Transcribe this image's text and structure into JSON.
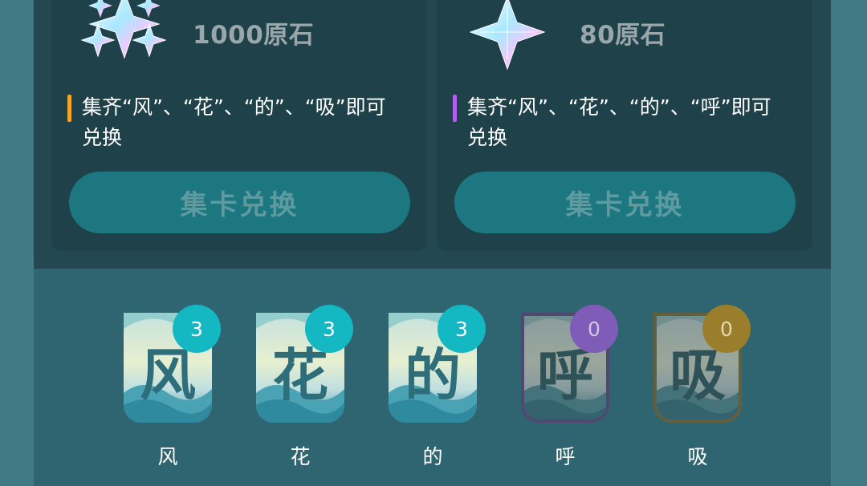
{
  "cards": [
    {
      "title": "1000原石",
      "desc_line1": "集齐“风”、“花”、“的”、“吸”即可",
      "desc_line2": "兑换",
      "accent": "#f5a623",
      "button": "集卡兑换"
    },
    {
      "title": "80原石",
      "desc_line1": "集齐“风”、“花”、“的”、“呼”即可",
      "desc_line2": "兑换",
      "accent": "#b35cf0",
      "button": "集卡兑换"
    }
  ],
  "tiles": [
    {
      "char": "风",
      "count": "3",
      "label": "风",
      "badge_color": "#14b8c2"
    },
    {
      "char": "花",
      "count": "3",
      "label": "花",
      "badge_color": "#14b8c2"
    },
    {
      "char": "的",
      "count": "3",
      "label": "的",
      "badge_color": "#14b8c2"
    },
    {
      "char": "呼",
      "count": "0",
      "label": "呼",
      "badge_color": "#7e5cb8"
    },
    {
      "char": "吸",
      "count": "0",
      "label": "吸",
      "badge_color": "#9a7e2c"
    }
  ]
}
